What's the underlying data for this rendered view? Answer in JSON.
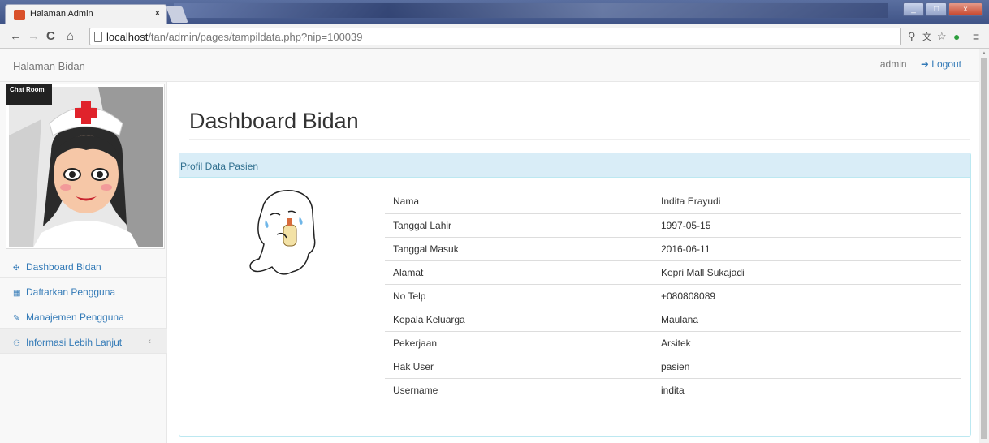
{
  "browser": {
    "tab_title": "Halaman Admin",
    "tab_close": "x",
    "url_host": "localhost",
    "url_path": "/tan/admin/pages/tampildata.php?nip=100039",
    "window_buttons": [
      "_",
      "□",
      "x"
    ]
  },
  "navbar": {
    "brand": "Halaman Bidan",
    "user": "admin",
    "logout": "Logout"
  },
  "sidebar": {
    "chat_label": "Chat Room",
    "items": [
      {
        "label": "Dashboard Bidan",
        "icon": "dashboard-icon"
      },
      {
        "label": "Daftarkan Pengguna",
        "icon": "table-icon"
      },
      {
        "label": "Manajemen Pengguna",
        "icon": "edit-icon"
      },
      {
        "label": "Informasi Lebih Lanjut",
        "icon": "sitemap-icon"
      }
    ]
  },
  "main": {
    "title": "Dashboard Bidan",
    "panel_heading": "Profil Data Pasien",
    "rows": [
      {
        "label": "Nama",
        "value": "Indita Erayudi"
      },
      {
        "label": "Tanggal Lahir",
        "value": "1997-05-15"
      },
      {
        "label": "Tanggal Masuk",
        "value": "2016-06-11"
      },
      {
        "label": "Alamat",
        "value": "Kepri Mall Sukajadi"
      },
      {
        "label": "No Telp",
        "value": "+080808089"
      },
      {
        "label": "Kepala Keluarga",
        "value": "Maulana"
      },
      {
        "label": "Pekerjaan",
        "value": "Arsitek"
      },
      {
        "label": "Hak User",
        "value": "pasien"
      },
      {
        "label": "Username",
        "value": "indita"
      }
    ]
  },
  "colors": {
    "link": "#337ab7",
    "panel_heading_bg": "#d9edf7",
    "panel_heading_text": "#31708f"
  }
}
